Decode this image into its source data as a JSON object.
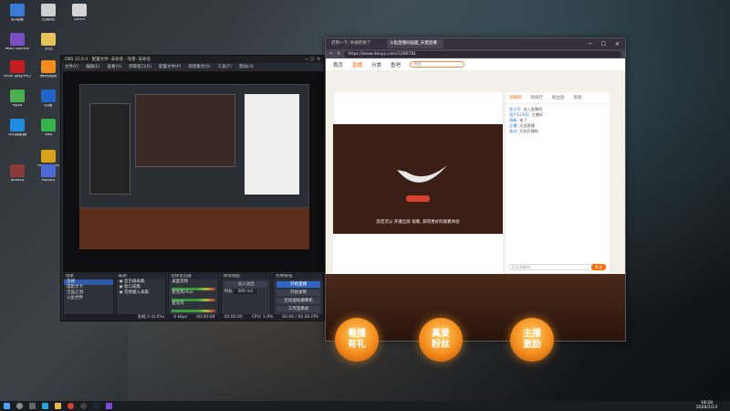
{
  "desktop": {
    "icons": [
      {
        "label": "此电脑",
        "color": "#3a7bd5"
      },
      {
        "label": "回收站",
        "color": "#cfcfcf"
      },
      {
        "label": "Mod Games",
        "color": "#7a4fc1"
      },
      {
        "label": "ROG 游戏中心",
        "color": "#c41e1e"
      },
      {
        "label": "腾讯视频",
        "color": "#f28c1e"
      },
      {
        "label": "Ryzo",
        "color": "#4caf50"
      },
      {
        "label": "UU加速器",
        "color": "#1f8ce0"
      },
      {
        "label": "迅雷",
        "color": "#2064c8"
      },
      {
        "label": "SAN14",
        "color": "#8b3a3a"
      },
      {
        "label": "文档",
        "color": "#e5c35a"
      },
      {
        "label": "DATA",
        "color": "#d4d4d4"
      },
      {
        "label": "360",
        "color": "#38b24a"
      },
      {
        "label": "Hollywood",
        "color": "#d9a21b"
      },
      {
        "label": "Assets",
        "color": "#4a6bd4"
      }
    ]
  },
  "obs": {
    "title": "OBS 32.0.4 - 配置文件: 未命名 - 场景: 未命名",
    "menu": [
      "文件(F)",
      "编辑(E)",
      "查看(V)",
      "停靠窗口(D)",
      "配置文件(P)",
      "场景集合(S)",
      "工具(T)",
      "帮助(H)"
    ],
    "docks": {
      "scenes": {
        "title": "场景",
        "items": [
          "直播",
          "电影大卡",
          "王国之泪",
          "斗鱼世界"
        ]
      },
      "sources": {
        "title": "来源",
        "items": [
          "显示器采集",
          "窗口采集",
          "音频输入采集"
        ]
      },
      "mixer": {
        "title": "音频混音器",
        "channels": [
          "桌面音频",
          "麦克风/Aux",
          "麦克风"
        ]
      },
      "transitions": {
        "title": "转场动画",
        "mode": "淡入淡出",
        "duration": "时长",
        "duration_value": "300 ms"
      },
      "controls": {
        "title": "控制按钮",
        "buttons": [
          "开始直播",
          "开始录制",
          "启动虚拟摄像机",
          "工作室模式",
          "设置",
          "退出"
        ]
      }
    },
    "status": [
      "丢帧 0 (0.0%)",
      "0 kbps",
      "00:00:00",
      "00:00:00",
      "CPU: 1.9%",
      "60.00 / 60.00 FPS"
    ]
  },
  "browser": {
    "tabs": [
      "迟到一下, 你被拒绝了",
      "斗鱼直播间画面_天使直播"
    ],
    "url": "https://www.douyu.com/5280781",
    "nav": {
      "items": [
        "首页",
        "直播",
        "分类",
        "鱼吧"
      ],
      "search_placeholder": "搜索"
    },
    "chat": {
      "tabs": [
        "贡献榜",
        "周排行",
        "粉丝团",
        "贵族"
      ],
      "messages": [
        {
          "user": "鱼小号",
          "text": "进入直播间"
        },
        {
          "user": "用户12345",
          "text": "主播好"
        },
        {
          "user": "萌新",
          "text": "来了"
        },
        {
          "user": "注播",
          "text": "天涯直播"
        },
        {
          "user": "本站",
          "text": "开始开播啦"
        }
      ],
      "input_placeholder": "发条弹幕吧",
      "send_label": "发送"
    },
    "stage_info": "您还可以 开播全屏 观看, 获得更好的观看体验",
    "badges": [
      {
        "line1": "看播",
        "line2": "有礼"
      },
      {
        "line1": "真爱",
        "line2": "粉丝"
      },
      {
        "line1": "主播",
        "line2": "激励"
      }
    ]
  },
  "taskbar": {
    "time": "18:28",
    "date": "2026/1/13"
  }
}
